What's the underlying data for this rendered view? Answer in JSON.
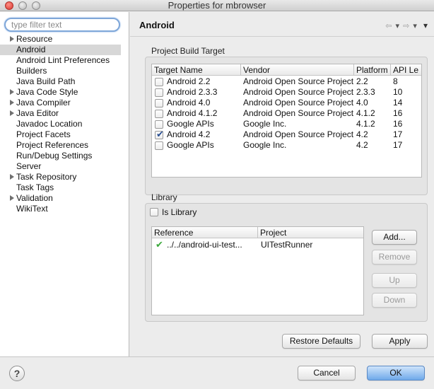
{
  "window": {
    "title": "Properties for mbrowser"
  },
  "sidebar": {
    "filter_placeholder": "type filter text",
    "items": [
      {
        "label": "Resource",
        "has_children": true
      },
      {
        "label": "Android",
        "selected": true
      },
      {
        "label": "Android Lint Preferences"
      },
      {
        "label": "Builders"
      },
      {
        "label": "Java Build Path"
      },
      {
        "label": "Java Code Style",
        "has_children": true
      },
      {
        "label": "Java Compiler",
        "has_children": true
      },
      {
        "label": "Java Editor",
        "has_children": true
      },
      {
        "label": "Javadoc Location"
      },
      {
        "label": "Project Facets"
      },
      {
        "label": "Project References"
      },
      {
        "label": "Run/Debug Settings"
      },
      {
        "label": "Server"
      },
      {
        "label": "Task Repository",
        "has_children": true
      },
      {
        "label": "Task Tags"
      },
      {
        "label": "Validation",
        "has_children": true
      },
      {
        "label": "WikiText"
      }
    ]
  },
  "page": {
    "title": "Android",
    "nav": {
      "back": "⇦",
      "forward": "⇨",
      "menu": "▾"
    }
  },
  "build_target": {
    "group_label": "Project Build Target",
    "columns": [
      "Target Name",
      "Vendor",
      "Platform",
      "API Le"
    ],
    "rows": [
      {
        "name": "Android 2.2",
        "vendor": "Android Open Source Project",
        "platform": "2.2",
        "api": "8",
        "checked": false
      },
      {
        "name": "Android 2.3.3",
        "vendor": "Android Open Source Project",
        "platform": "2.3.3",
        "api": "10",
        "checked": false
      },
      {
        "name": "Android 4.0",
        "vendor": "Android Open Source Project",
        "platform": "4.0",
        "api": "14",
        "checked": false
      },
      {
        "name": "Android 4.1.2",
        "vendor": "Android Open Source Project",
        "platform": "4.1.2",
        "api": "16",
        "checked": false
      },
      {
        "name": "Google APIs",
        "vendor": "Google Inc.",
        "platform": "4.1.2",
        "api": "16",
        "checked": false
      },
      {
        "name": "Android 4.2",
        "vendor": "Android Open Source Project",
        "platform": "4.2",
        "api": "17",
        "checked": true
      },
      {
        "name": "Google APIs",
        "vendor": "Google Inc.",
        "platform": "4.2",
        "api": "17",
        "checked": false
      }
    ]
  },
  "library": {
    "group_label": "Library",
    "is_library_label": "Is Library",
    "is_library_checked": false,
    "columns": [
      "Reference",
      "Project"
    ],
    "rows": [
      {
        "reference": "../../android-ui-test...",
        "project": "UITestRunner"
      }
    ],
    "buttons": {
      "add": "Add...",
      "remove": "Remove",
      "up": "Up",
      "down": "Down"
    }
  },
  "actions": {
    "restore_defaults": "Restore Defaults",
    "apply": "Apply",
    "cancel": "Cancel",
    "ok": "OK",
    "help": "?"
  },
  "colors": {
    "accent": "#6fa9ea",
    "check_green": "#3aa83a",
    "selection": "#d7d7d7"
  }
}
